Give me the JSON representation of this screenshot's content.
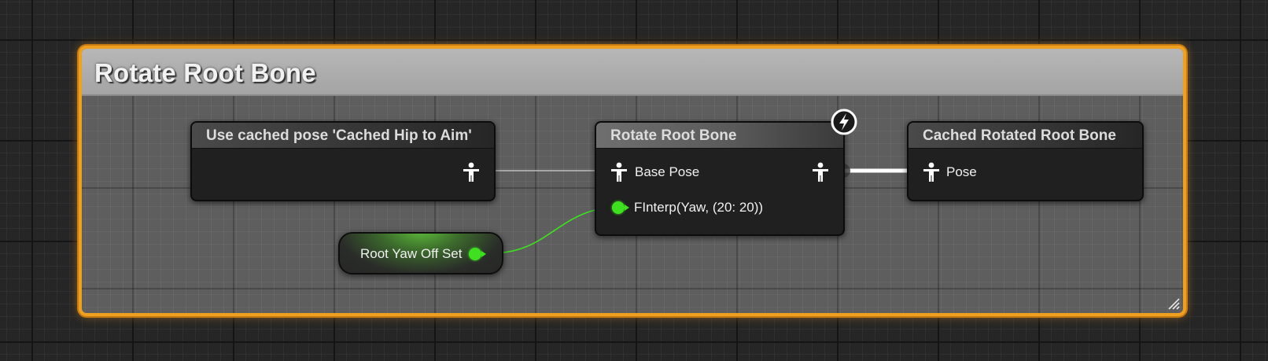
{
  "comment": {
    "title": "Rotate Root Bone"
  },
  "nodes": {
    "cached_pose_use": {
      "title": "Use cached pose 'Cached Hip to Aim'"
    },
    "rotate_root_bone": {
      "title": "Rotate Root Bone",
      "pins": {
        "base_pose": "Base Pose",
        "yaw": "FInterp(Yaw, (20: 20))"
      }
    },
    "cached_rotated": {
      "title": "Cached Rotated Root Bone",
      "pins": {
        "pose": "Pose"
      }
    },
    "variable": {
      "label": "Root Yaw Off Set"
    }
  },
  "colors": {
    "comment_border": "#f0a020",
    "float_pin": "#3ee020",
    "exec_wire": "#ffffff"
  },
  "icons": [
    "pose-icon",
    "fast-path-lightning-icon",
    "resize-grip-icon"
  ]
}
